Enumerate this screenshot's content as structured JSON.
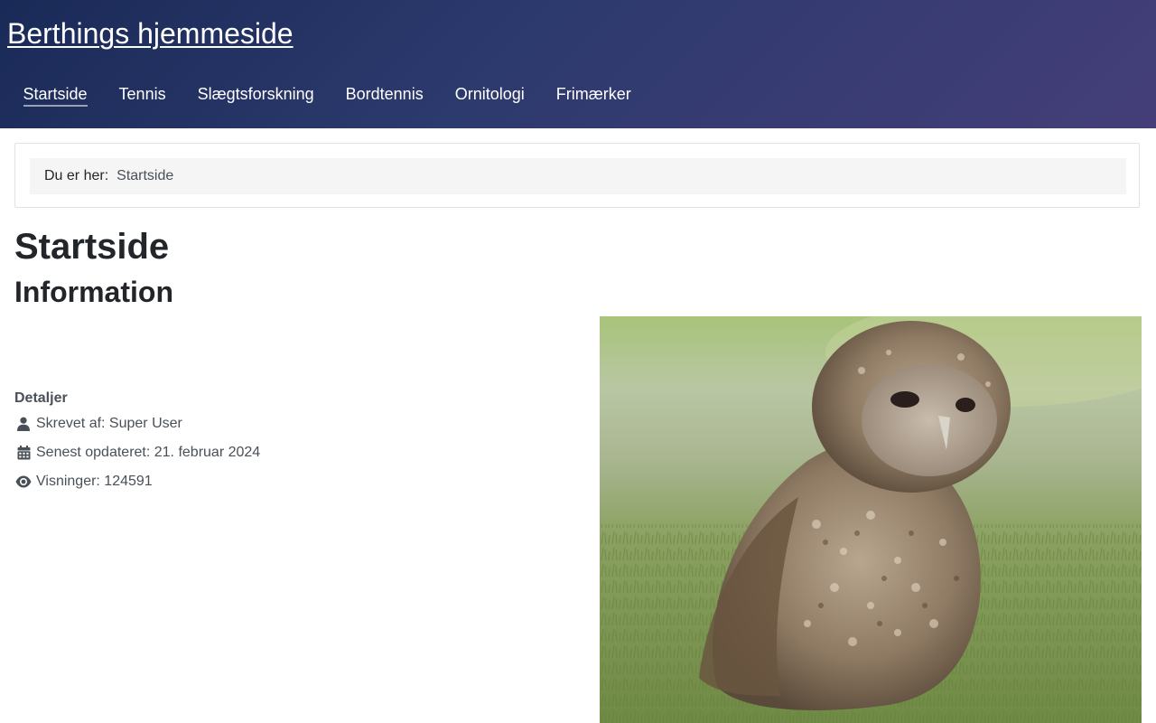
{
  "site": {
    "title": "Berthings hjemmeside"
  },
  "nav": {
    "items": [
      {
        "label": "Startside",
        "active": true
      },
      {
        "label": "Tennis",
        "active": false
      },
      {
        "label": "Slægtsforskning",
        "active": false
      },
      {
        "label": "Bordtennis",
        "active": false
      },
      {
        "label": "Ornitologi",
        "active": false
      },
      {
        "label": "Frimærker",
        "active": false
      }
    ]
  },
  "breadcrumb": {
    "label": "Du er her:",
    "current": "Startside"
  },
  "page": {
    "title": "Startside",
    "section_title": "Information"
  },
  "details": {
    "heading": "Detaljer",
    "author": {
      "icon": "user-icon",
      "text": "Skrevet af: Super User"
    },
    "updated": {
      "icon": "calendar-icon",
      "text": "Senest opdateret: 21. februar 2024"
    },
    "views": {
      "icon": "eye-icon",
      "text": "Visninger: 124591"
    }
  },
  "image": {
    "subject": "owl-chick-photo"
  },
  "colors": {
    "header_start": "#1a2a57",
    "header_end": "#453e78",
    "text": "#22262a",
    "muted": "#495057",
    "breadcrumb_bg": "#f5f5f5"
  }
}
